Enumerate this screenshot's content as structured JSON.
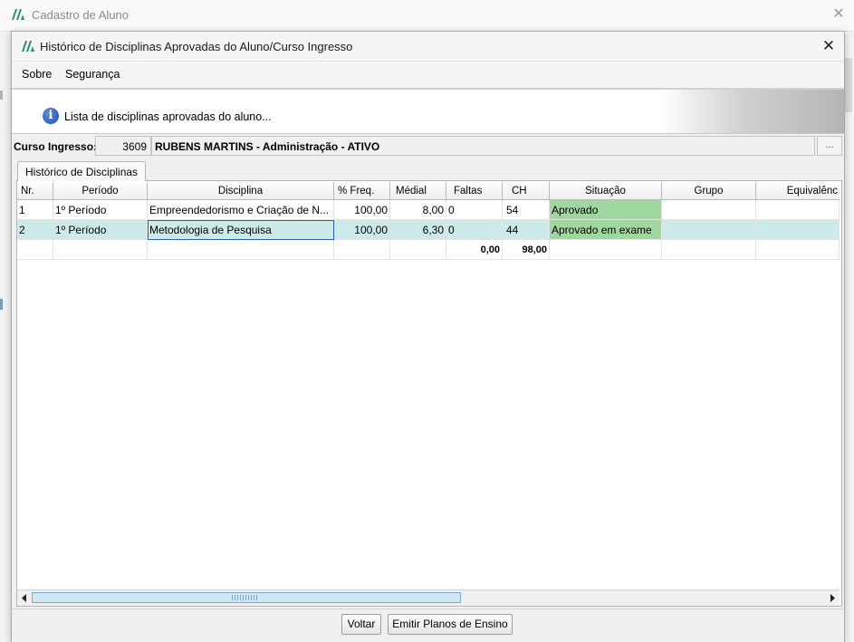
{
  "outer_window": {
    "title": "Cadastro de Aluno",
    "close_glyph": "✕"
  },
  "dialog": {
    "title": "Histórico de Disciplinas Aprovadas do Aluno/Curso Ingresso",
    "close_glyph": "✕"
  },
  "menu": {
    "items": [
      {
        "label": "Sobre"
      },
      {
        "label": "Segurança"
      }
    ]
  },
  "banner": {
    "icon": "info-icon",
    "icon_glyph": "i",
    "text": "Lista de disciplinas aprovadas do aluno..."
  },
  "curso": {
    "label": "Curso Ingresso:",
    "code": "3609",
    "name": "RUBENS MARTINS - Administração - ATIVO",
    "button_label": "..."
  },
  "tab": {
    "label": "Histórico de Disciplinas"
  },
  "table": {
    "headers": [
      "Nr.",
      "Período",
      "Disciplina",
      "% Freq.",
      "Médial",
      "Faltas",
      "CH",
      "Situação",
      "Grupo",
      "Equivalênc"
    ],
    "rows": [
      {
        "nr": "1",
        "periodo": "1º Período",
        "disciplina": "Empreendedorismo e Criação de N...",
        "freq": "100,00",
        "media": "8,00",
        "faltas": "0",
        "ch": "54",
        "situacao": "Aprovado",
        "grupo": "",
        "equivalencia": ""
      },
      {
        "nr": "2",
        "periodo": "1º Período",
        "disciplina": "Metodologia de Pesquisa",
        "freq": "100,00",
        "media": "6,30",
        "faltas": "0",
        "ch": "44",
        "situacao": "Aprovado em exame",
        "grupo": "",
        "equivalencia": ""
      }
    ],
    "totals": {
      "faltas": "0,00",
      "ch": "98,00"
    }
  },
  "footer": {
    "voltar_label": "Voltar",
    "emitir_label": "Emitir Planos de Ensino"
  },
  "colors": {
    "green": "#9fd89f",
    "selected_row": "#cdeaea",
    "logo": "#1e8f78"
  }
}
